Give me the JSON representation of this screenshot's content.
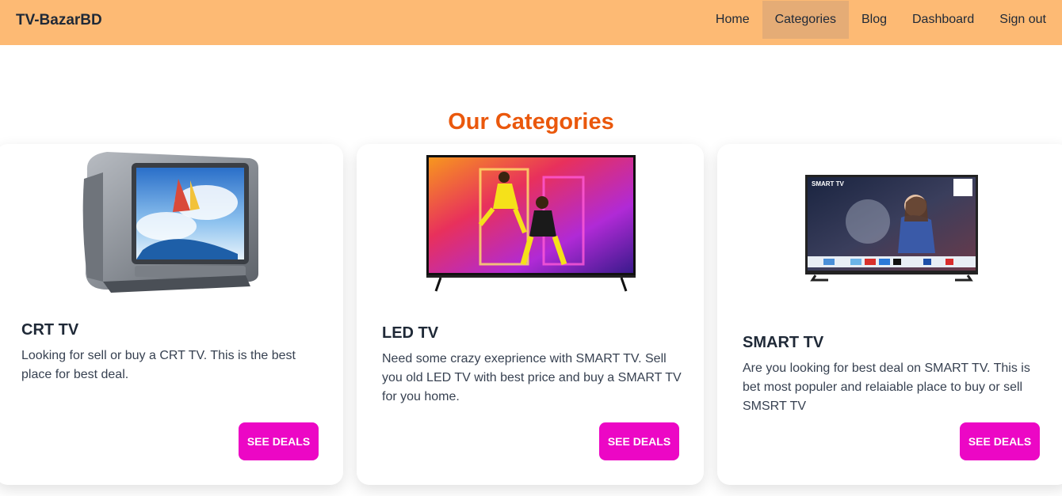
{
  "nav": {
    "brand": "TV-BazarBD",
    "items": [
      {
        "label": "Home"
      },
      {
        "label": "Categories",
        "active": true
      },
      {
        "label": "Blog"
      },
      {
        "label": "Dashboard"
      },
      {
        "label": "Sign out"
      }
    ]
  },
  "section": {
    "title": "Our Categories"
  },
  "cards": [
    {
      "title": "CRT TV",
      "description": "Looking for sell or buy a CRT TV. This is the best place for best deal.",
      "button": "SEE DEALS"
    },
    {
      "title": "LED TV",
      "description": "Need some crazy exeprience with SMART TV. Sell you old LED TV with best price and buy a SMART TV for you home.",
      "button": "SEE DEALS"
    },
    {
      "title": "SMART TV",
      "description": "Are you looking for best deal on SMART TV. This is bet most populer and relaiable place to buy or sell SMSRT TV",
      "button": "SEE DEALS",
      "screen_text": "SMART TV"
    }
  ],
  "colors": {
    "navbar": "#fdba74",
    "active_nav": "#e5ac76",
    "title": "#ea580c",
    "button": "#ec07c5"
  }
}
